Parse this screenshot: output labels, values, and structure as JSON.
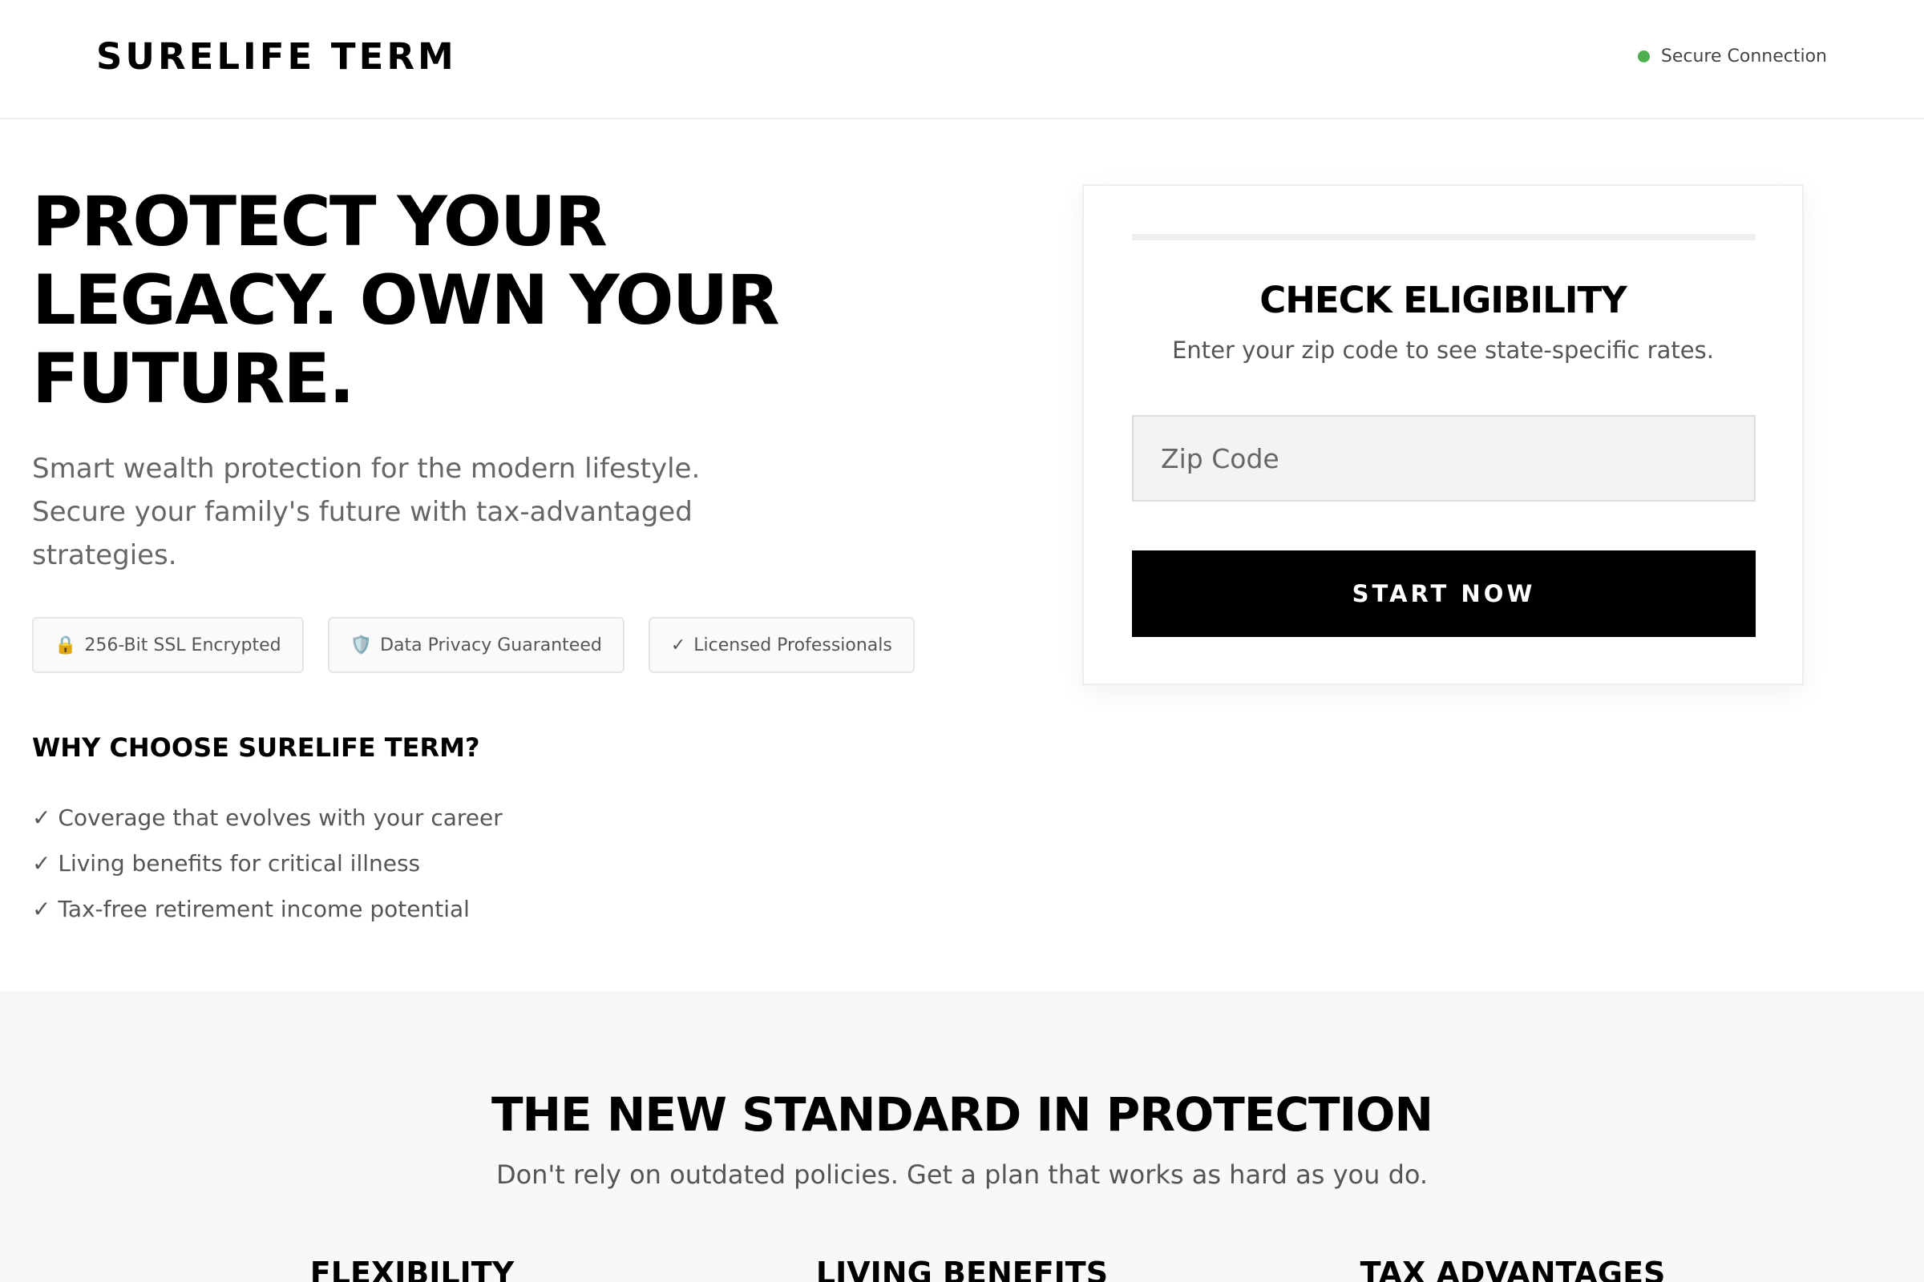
{
  "header": {
    "logo": "SURELIFE TERM",
    "secure_label": "Secure Connection",
    "secure_color": "#4caf50"
  },
  "hero": {
    "title": "PROTECT YOUR LEGACY. OWN YOUR FUTURE.",
    "subtitle": "Smart wealth protection for the modern lifestyle. Secure your family's future with tax-advantaged strategies."
  },
  "badges": [
    {
      "icon": "lock-icon",
      "glyph": "🔒",
      "label": "256-Bit SSL Encrypted"
    },
    {
      "icon": "shield-icon",
      "glyph": "🛡️",
      "label": "Data Privacy Guaranteed"
    },
    {
      "icon": "check-icon",
      "glyph": "✓",
      "label": "Licensed Professionals"
    }
  ],
  "why": {
    "title": "WHY CHOOSE SURELIFE TERM?",
    "items": [
      "✓ Coverage that evolves with your career",
      "✓ Living benefits for critical illness",
      "✓ Tax-free retirement income potential"
    ]
  },
  "eligibility": {
    "title": "CHECK ELIGIBILITY",
    "subtitle": "Enter your zip code to see state-specific rates.",
    "zip_placeholder": "Zip Code",
    "zip_value": "",
    "button_label": "START NOW"
  },
  "standard": {
    "title": "THE NEW STANDARD IN PROTECTION",
    "subtitle": "Don't rely on outdated policies. Get a plan that works as hard as you do.",
    "features": [
      "FLEXIBILITY",
      "LIVING BENEFITS",
      "TAX ADVANTAGES"
    ]
  }
}
